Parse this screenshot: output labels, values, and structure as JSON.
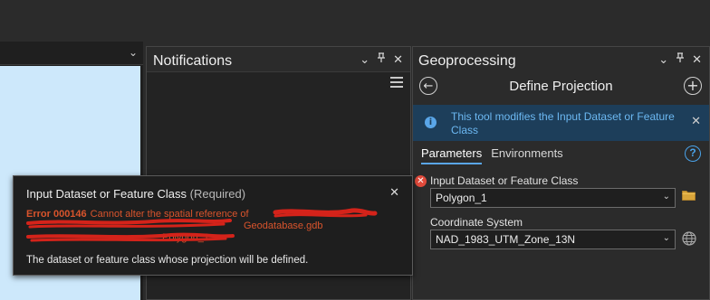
{
  "notifications": {
    "title": "Notifications"
  },
  "geoprocessing": {
    "title": "Geoprocessing",
    "tool_title": "Define Projection",
    "info_message": "This tool modifies the Input Dataset or Feature Class",
    "tabs": [
      {
        "label": "Parameters",
        "active": true
      },
      {
        "label": "Environments",
        "active": false
      }
    ],
    "params": {
      "input_label": "Input Dataset or Feature Class",
      "input_value": "Polygon_1",
      "cs_label": "Coordinate System",
      "cs_value": "NAD_1983_UTM_Zone_13N"
    }
  },
  "popup": {
    "title": "Input Dataset or Feature Class",
    "required": "(Required)",
    "error_code": "Error 000146",
    "error_text": "Cannot alter the spatial reference of",
    "error_line2": "Geodatabase.gdb",
    "error_line3": "Polygon_1",
    "description": "The dataset or feature class whose projection will be defined."
  },
  "colors": {
    "accent": "#5aa6e8",
    "error": "#d9542c",
    "info_bg": "#1d3e5a",
    "map_bg": "#cde8fb"
  }
}
